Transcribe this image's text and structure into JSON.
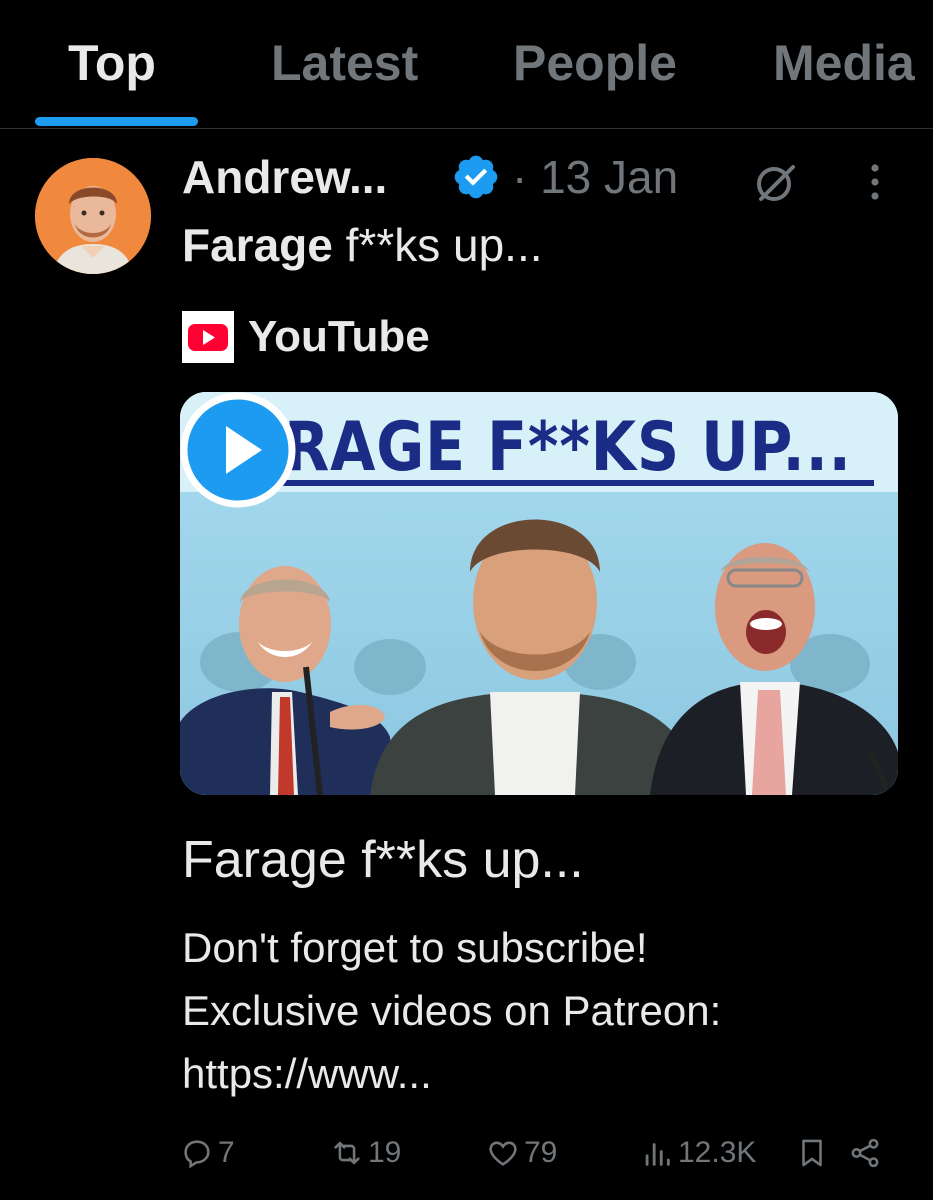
{
  "tabs": [
    {
      "label": "Top",
      "active": true
    },
    {
      "label": "Latest",
      "active": false
    },
    {
      "label": "People",
      "active": false
    },
    {
      "label": "Media",
      "active": false
    }
  ],
  "post": {
    "author": "Andrew...",
    "date": "· 13 Jan",
    "text_bold": "Farage",
    "text_rest": " f**ks up...",
    "icons": [
      "verified-badge-icon",
      "grok-icon",
      "more-icon"
    ]
  },
  "card": {
    "source": "YouTube",
    "thumbnail_text": "FARAGE F**KS UP...",
    "title": "Farage f**ks up...",
    "desc_line1": "Don't forget to subscribe!",
    "desc_line2": "Exclusive videos on Patreon:",
    "desc_line3": "https://www..."
  },
  "actions": {
    "replies": "7",
    "reposts": "19",
    "likes": "79",
    "views": "12.3K"
  },
  "colors": {
    "accent": "#1d9bf0",
    "text": "#e7e9ea",
    "muted": "#71767b",
    "background": "#000000"
  }
}
